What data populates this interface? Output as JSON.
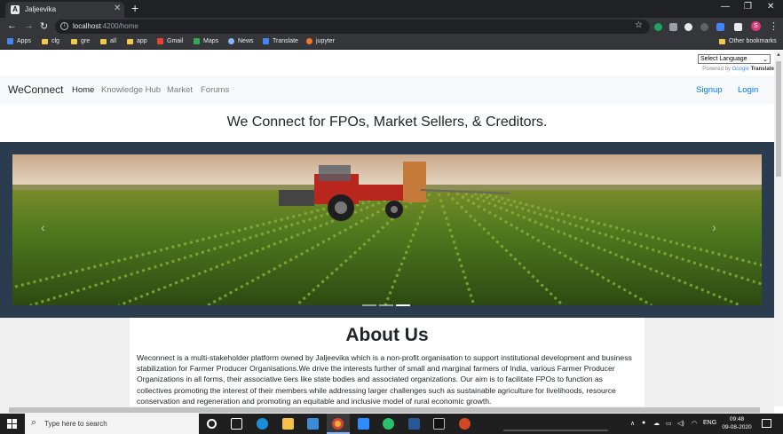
{
  "browser": {
    "tab": {
      "title": "Jaljeevika",
      "favicon": "A"
    },
    "url": {
      "host": "localhost",
      "path": ":4200/home"
    },
    "bookmarks": [
      {
        "label": "Apps",
        "icon": "apps-grid-icon"
      },
      {
        "label": "clg",
        "icon": "folder-icon"
      },
      {
        "label": "gre",
        "icon": "folder-icon"
      },
      {
        "label": "all",
        "icon": "folder-icon"
      },
      {
        "label": "app",
        "icon": "folder-icon"
      },
      {
        "label": "Gmail",
        "icon": "gmail-icon"
      },
      {
        "label": "Maps",
        "icon": "maps-icon"
      },
      {
        "label": "News",
        "icon": "news-icon"
      },
      {
        "label": "Translate",
        "icon": "translate-icon"
      },
      {
        "label": "jupyter",
        "icon": "jupyter-icon"
      }
    ],
    "other_bookmarks": "Other bookmarks",
    "profile_initial": "S"
  },
  "translate_widget": {
    "select_label": "Select Language",
    "powered_prefix": "Powered by",
    "powered_google": "Google",
    "powered_translate": "Translate"
  },
  "navbar": {
    "brand": "WeConnect",
    "links": [
      "Home",
      "Knowledge Hub",
      "Market",
      "Forums"
    ],
    "signup": "Signup",
    "login": "Login"
  },
  "headline": "We Connect for FPOs, Market Sellers, & Creditors.",
  "carousel": {
    "slide_count": 3,
    "active_index": 2
  },
  "about": {
    "heading": "About Us",
    "body": "Weconnect is a multi-stakeholder platform owned by Jaljeevika which is a non-profit organisation to support institutional development and business stabilization for Farmer Producer Organisations.We drive the interests further of small and marginal farmers of India, various Farmer Producer Organizations in all forms, their associative tiers like state bodies and associated organizations. Our aim is to facilitate FPOs to function as collectives promoting the interest of their members while addressing larger challenges such as sustainable agriculture for livelihoods, resource conservation and regeneration and promoting an equitable and inclusive model of rural economic growth."
  },
  "taskbar": {
    "search_placeholder": "Type here to search",
    "lang": "ENG",
    "time": "09:48",
    "date": "09-08-2020"
  },
  "colors": {
    "brand_link": "#007bff",
    "carousel_bg": "#2b3c4e",
    "tractor_red": "#b8261d"
  }
}
